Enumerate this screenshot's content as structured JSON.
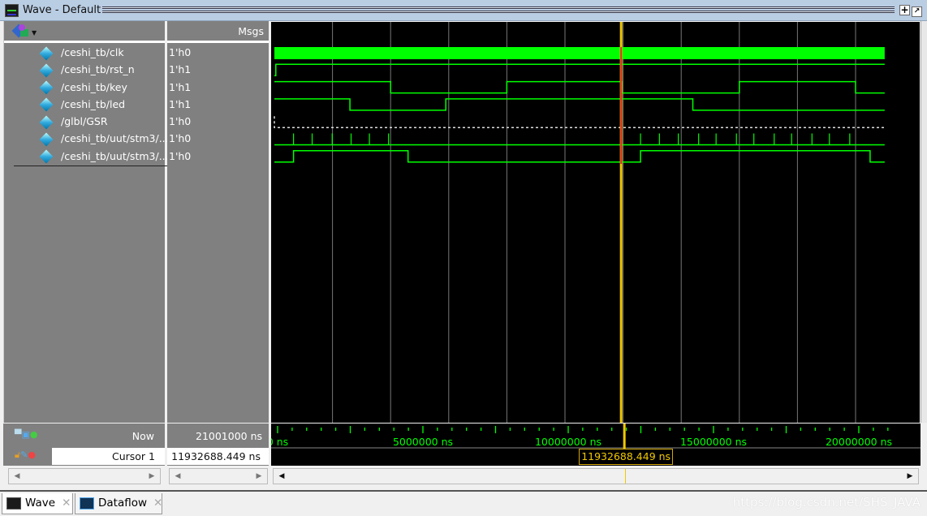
{
  "window": {
    "title": "Wave - Default"
  },
  "header": {
    "msgs_label": "Msgs"
  },
  "signals": [
    {
      "name": "/ceshi_tb/clk",
      "value": "1'h0",
      "kind": "clock"
    },
    {
      "name": "/ceshi_tb/rst_n",
      "value": "1'h1",
      "init": 0,
      "edges": [
        0.05
      ]
    },
    {
      "name": "/ceshi_tb/key",
      "value": "1'h1",
      "init": 1,
      "edges": [
        4.0,
        8.0,
        11.96,
        16.0,
        20.0
      ]
    },
    {
      "name": "/ceshi_tb/led",
      "value": "1'h1",
      "init": 1,
      "edges": [
        2.6,
        5.9,
        14.4
      ]
    },
    {
      "name": "/glbl/GSR",
      "value": "1'h0",
      "kind": "dashed"
    },
    {
      "name": "/ceshi_tb/uut/stm3/...",
      "value": "1'h0",
      "kind": "pulses",
      "pulses": [
        0.66,
        1.3,
        1.99,
        2.64,
        3.27,
        3.93,
        12.6,
        13.25,
        13.9,
        14.6,
        15.2,
        15.9,
        16.5,
        17.2,
        17.8,
        18.5,
        19.1,
        19.8
      ]
    },
    {
      "name": "/ceshi_tb/uut/stm3/...",
      "value": "1'h0",
      "init": 0,
      "edges": [
        0.66,
        4.6,
        12.6,
        20.5
      ]
    }
  ],
  "time": {
    "unit_note": "edges in millions of ns",
    "end": 21.001,
    "axis_labels": [
      "0 ns",
      "5000000 ns",
      "10000000 ns",
      "15000000 ns",
      "20000000 ns"
    ],
    "grid_step": 2.0
  },
  "status": {
    "now_label": "Now",
    "now_value": "21001000 ns",
    "cursor_label": "Cursor 1",
    "cursor_value": "11932688.449 ns",
    "cursor_time": 11.932688449
  },
  "colors": {
    "wave": "#00ff00",
    "cursor": "#f0c800",
    "background": "#000000"
  },
  "tabs": [
    {
      "label": "Wave"
    },
    {
      "label": "Dataflow"
    }
  ],
  "watermark": "https://blog.csdn.net/SHS_JAVA"
}
